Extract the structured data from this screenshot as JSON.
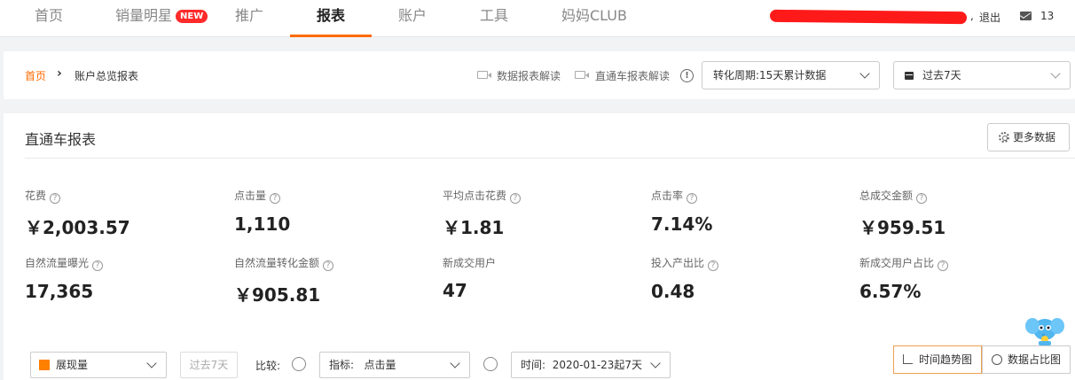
{
  "nav": {
    "items": [
      {
        "label": "首页"
      },
      {
        "label": "销量明星",
        "badge": "NEW"
      },
      {
        "label": "推广"
      },
      {
        "label": "报表"
      },
      {
        "label": "账户"
      },
      {
        "label": "工具"
      },
      {
        "label": "妈妈CLUB"
      }
    ],
    "active_index": 3,
    "logout": "退出",
    "mail_count": "13"
  },
  "breadcrumb": {
    "home": "首页",
    "current": "账户总览报表"
  },
  "toolbar": {
    "data_report_guide": "数据报表解读",
    "ztc_report_guide": "直通车报表解读",
    "conversion_period": "转化周期:15天累计数据",
    "date_range": "过去7天"
  },
  "panel": {
    "title": "直通车报表",
    "more_data": "更多数据"
  },
  "metrics": [
    {
      "label": "花费",
      "value": "￥2,003.57"
    },
    {
      "label": "点击量",
      "value": "1,110"
    },
    {
      "label": "平均点击花费",
      "value": "￥1.81"
    },
    {
      "label": "点击率",
      "value": "7.14%"
    },
    {
      "label": "总成交金额",
      "value": "￥959.51"
    },
    {
      "label": "自然流量曝光",
      "value": "17,365"
    },
    {
      "label": "自然流量转化金额",
      "value": "￥905.81"
    },
    {
      "label": "新成交用户",
      "value": "47"
    },
    {
      "label": "投入产出比",
      "value": "0.48"
    },
    {
      "label": "新成交用户占比",
      "value": "6.57%"
    }
  ],
  "controls": {
    "metric_select": "展现量",
    "past_7_days": "过去7天",
    "compare_label": "比较:",
    "indicator_label": "指标:",
    "indicator_value": "点击量",
    "time_label": "时间:",
    "time_value": "2020-01-23起7天",
    "trend_view": "时间趋势图",
    "share_view": "数据占比图"
  },
  "colors": {
    "accent": "#ff6a00",
    "badge": "#ff2a2a",
    "redaction": "#ff1a1a"
  }
}
